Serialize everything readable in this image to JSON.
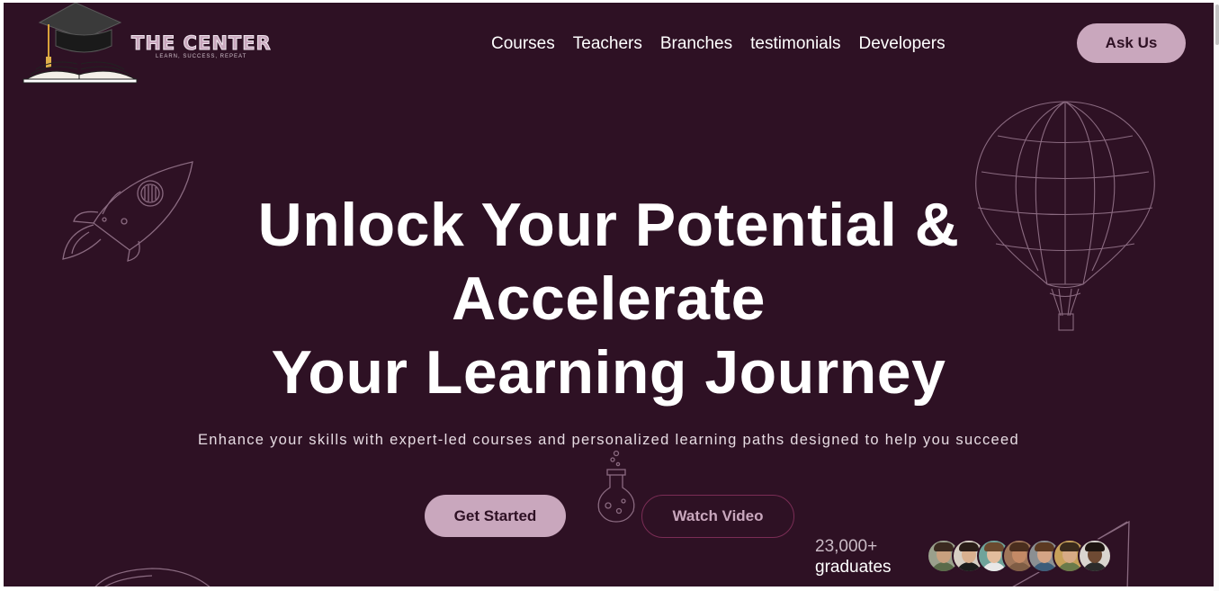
{
  "brand": {
    "title": "THE CENTER",
    "tagline": "LEARN, SUCCESS, REPEAT"
  },
  "nav": {
    "items": [
      "Courses",
      "Teachers",
      "Branches",
      "testimonials",
      "Developers"
    ],
    "cta": "Ask Us"
  },
  "hero": {
    "title_lines": [
      "Unlock Your Potential &",
      "Accelerate",
      "Your Learning Journey"
    ],
    "subtitle": "Enhance your skills with expert-led courses and personalized learning paths designed to help you succeed",
    "primary_button": "Get Started",
    "secondary_button": "Watch Video"
  },
  "graduates": {
    "count": "23,000+",
    "label": "graduates",
    "avatars": [
      {
        "icon": "avatar-1",
        "bg": "#9aa08c",
        "skin": "#c9a07e",
        "hair": "#3b2a20",
        "shirt": "#5a6b4a"
      },
      {
        "icon": "avatar-2",
        "bg": "#d6cfc4",
        "skin": "#d9b08f",
        "hair": "#2a1d18",
        "shirt": "#1c1c1c"
      },
      {
        "icon": "avatar-3",
        "bg": "#6fa39a",
        "skin": "#e2bc9d",
        "hair": "#6b4a2f",
        "shirt": "#e8e8e8"
      },
      {
        "icon": "avatar-4",
        "bg": "#a0765a",
        "skin": "#c48a66",
        "hair": "#4a2e1e",
        "shirt": "#7f5d45"
      },
      {
        "icon": "avatar-5",
        "bg": "#8b8f92",
        "skin": "#d4a485",
        "hair": "#5c3a22",
        "shirt": "#3d5d7a"
      },
      {
        "icon": "avatar-6",
        "bg": "#c7a15a",
        "skin": "#d7aa85",
        "hair": "#3a2a1c",
        "shirt": "#6a7a4a"
      },
      {
        "icon": "avatar-7",
        "bg": "#d9d5cf",
        "skin": "#6e4a33",
        "hair": "#1e1511",
        "shirt": "#2b2b2b"
      }
    ]
  },
  "colors": {
    "background": "#2e1124",
    "accent": "#c9a7bd",
    "text": "#ffffff",
    "outline": "#7a2d55"
  },
  "icons": [
    "graduation-cap-icon",
    "open-book-icon",
    "rocket-icon",
    "hot-air-balloon-icon",
    "flask-icon"
  ]
}
